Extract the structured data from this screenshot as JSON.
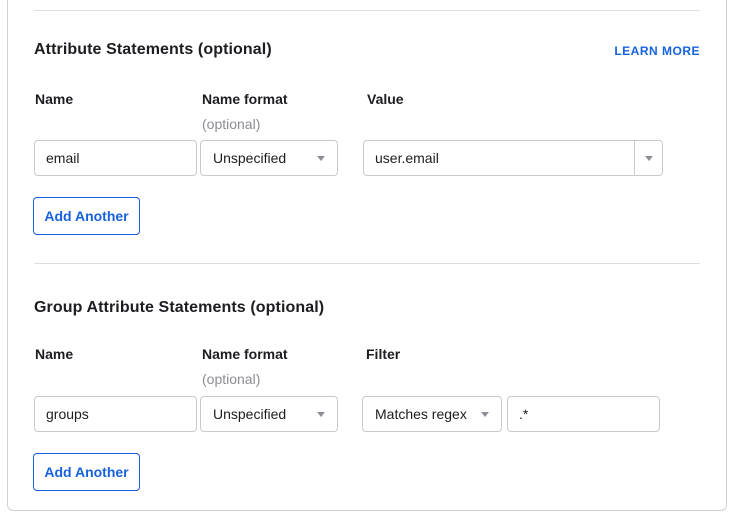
{
  "panel": {
    "attribute_section": {
      "heading": "Attribute Statements (optional)",
      "learn_more_label": "LEARN MORE",
      "columns": {
        "name": "Name",
        "name_format": "Name format",
        "name_format_sub": "(optional)",
        "value": "Value"
      },
      "row": {
        "name": "email",
        "name_format": "Unspecified",
        "value": "user.email"
      },
      "add_button_label": "Add Another"
    },
    "group_section": {
      "heading": "Group Attribute Statements (optional)",
      "columns": {
        "name": "Name",
        "name_format": "Name format",
        "name_format_sub": "(optional)",
        "filter": "Filter"
      },
      "row": {
        "name": "groups",
        "name_format": "Unspecified",
        "filter_type": "Matches regex",
        "filter_value": ".*"
      },
      "add_button_label": "Add Another"
    }
  },
  "colors": {
    "link_blue": "#1662dd",
    "text": "#1d1d21",
    "muted_gray": "#8c8c96",
    "input_border": "#c9c9cf",
    "card_border": "#cfcfd4",
    "divider": "#dededf",
    "background": "#ffffff"
  }
}
